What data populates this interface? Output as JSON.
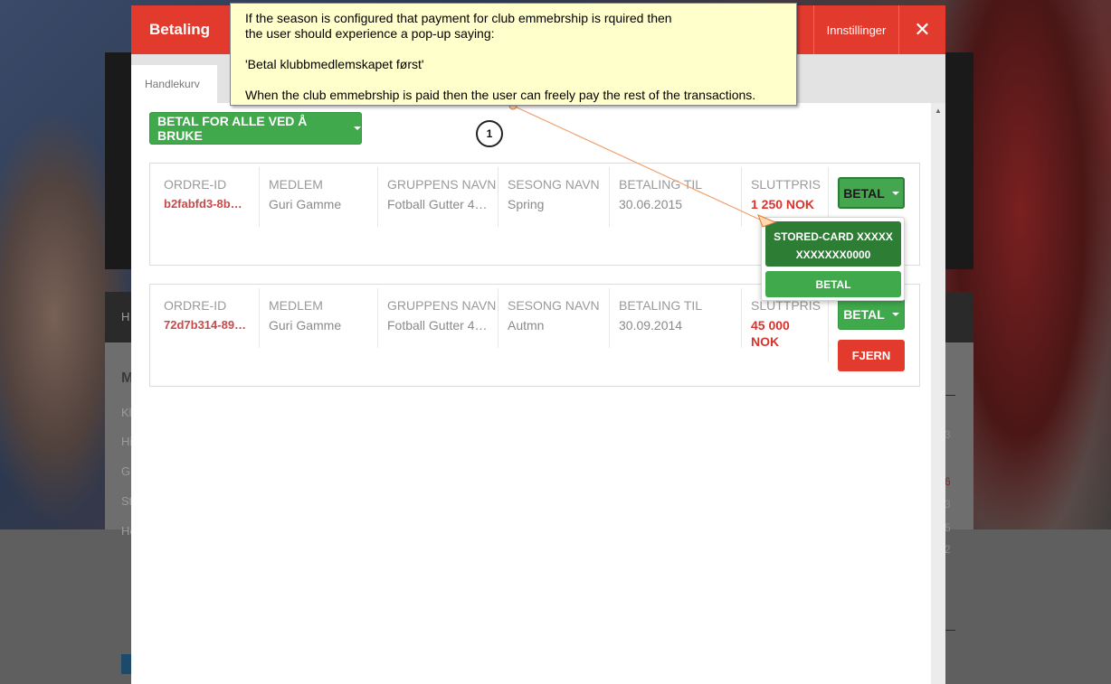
{
  "modal": {
    "title": "Betaling",
    "settings_label": "Innstillinger",
    "close_glyph": "✕",
    "tab": "Handlekurv",
    "pay_all_label": "BETAL FOR ALLE VED Å BRUKE"
  },
  "columns": {
    "order_id": "ORDRE-ID",
    "member": "MEDLEM",
    "group": "GRUPPENS NAVN",
    "season": "SESONG NAVN",
    "pay_by": "BETALING TIL",
    "final_price": "SLUTTPRIS"
  },
  "orders": [
    {
      "id": "b2fabfd3-8b…",
      "member": "Guri Gamme",
      "group": "Fotball Gutter 4…",
      "season": "Spring",
      "pay_by": "30.06.2015",
      "price": "1 250 NOK",
      "pay_label": "BETAL"
    },
    {
      "id": "72d7b314-89…",
      "member": "Guri Gamme",
      "group": "Fotball Gutter 4…",
      "season": "Autmn",
      "pay_by": "30.09.2014",
      "price_line1": "45 000",
      "price_line2": "NOK",
      "pay_label": "BETAL",
      "remove_label": "FJERN"
    }
  ],
  "dropdown": {
    "card_line1": "STORED-CARD XXXXX",
    "card_line2": "XXXXXXX0000",
    "pay_label": "BETAL"
  },
  "annotation": {
    "line1": "If the season is configured that payment for club emmebrship is rquired then",
    "line2": "the user should experience a pop-up saying:",
    "quote": "'Betal klubbmedlemskapet først'",
    "line3": "When the club emmebrship is paid then the user can freely pay the rest of the transactions.",
    "badge": "1"
  },
  "background": {
    "nav_letter": "H",
    "list_letters": [
      "M",
      "Kl",
      "Hi",
      "Gi",
      "St",
      "He"
    ],
    "right_numbers": [
      "3",
      "6",
      "3",
      "5",
      "2",
      "9"
    ]
  },
  "colors": {
    "header_red": "#e23b2e",
    "green": "#3fa94c",
    "dark_green": "#2e7d34",
    "price_red": "#d9342b",
    "note_yellow": "#ffffcc"
  }
}
